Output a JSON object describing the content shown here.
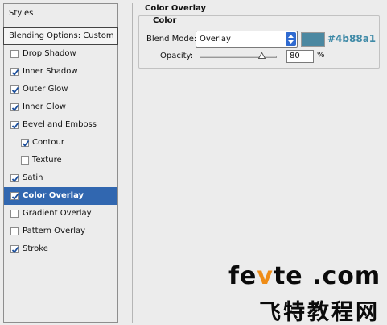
{
  "styles_panel": {
    "header": "Styles",
    "blending_options": "Blending Options: Custom",
    "items": [
      {
        "label": "Drop Shadow",
        "checked": false,
        "selected": false,
        "sub": false
      },
      {
        "label": "Inner Shadow",
        "checked": true,
        "selected": false,
        "sub": false
      },
      {
        "label": "Outer Glow",
        "checked": true,
        "selected": false,
        "sub": false
      },
      {
        "label": "Inner Glow",
        "checked": true,
        "selected": false,
        "sub": false
      },
      {
        "label": "Bevel and Emboss",
        "checked": true,
        "selected": false,
        "sub": false
      },
      {
        "label": "Contour",
        "checked": true,
        "selected": false,
        "sub": true
      },
      {
        "label": "Texture",
        "checked": false,
        "selected": false,
        "sub": true
      },
      {
        "label": "Satin",
        "checked": true,
        "selected": false,
        "sub": false
      },
      {
        "label": "Color Overlay",
        "checked": true,
        "selected": true,
        "sub": false
      },
      {
        "label": "Gradient Overlay",
        "checked": false,
        "selected": false,
        "sub": false
      },
      {
        "label": "Pattern Overlay",
        "checked": false,
        "selected": false,
        "sub": false
      },
      {
        "label": "Stroke",
        "checked": true,
        "selected": false,
        "sub": false
      }
    ]
  },
  "options": {
    "section_title": "Color Overlay",
    "group_title": "Color",
    "blend_mode_label": "Blend Mode:",
    "blend_mode_value": "Overlay",
    "color_hex": "#4b88a1",
    "opacity_label": "Opacity:",
    "opacity_value": "80",
    "opacity_unit": "%",
    "opacity_fraction": 0.8
  },
  "watermark": {
    "en_prefix": "fe",
    "en_v": "v",
    "en_suffix": "te .com",
    "cn": "飞特教程网"
  },
  "colors": {
    "selection": "#3167b0",
    "swatch": "#4b88a1",
    "accent_v": "#ef8c16"
  }
}
